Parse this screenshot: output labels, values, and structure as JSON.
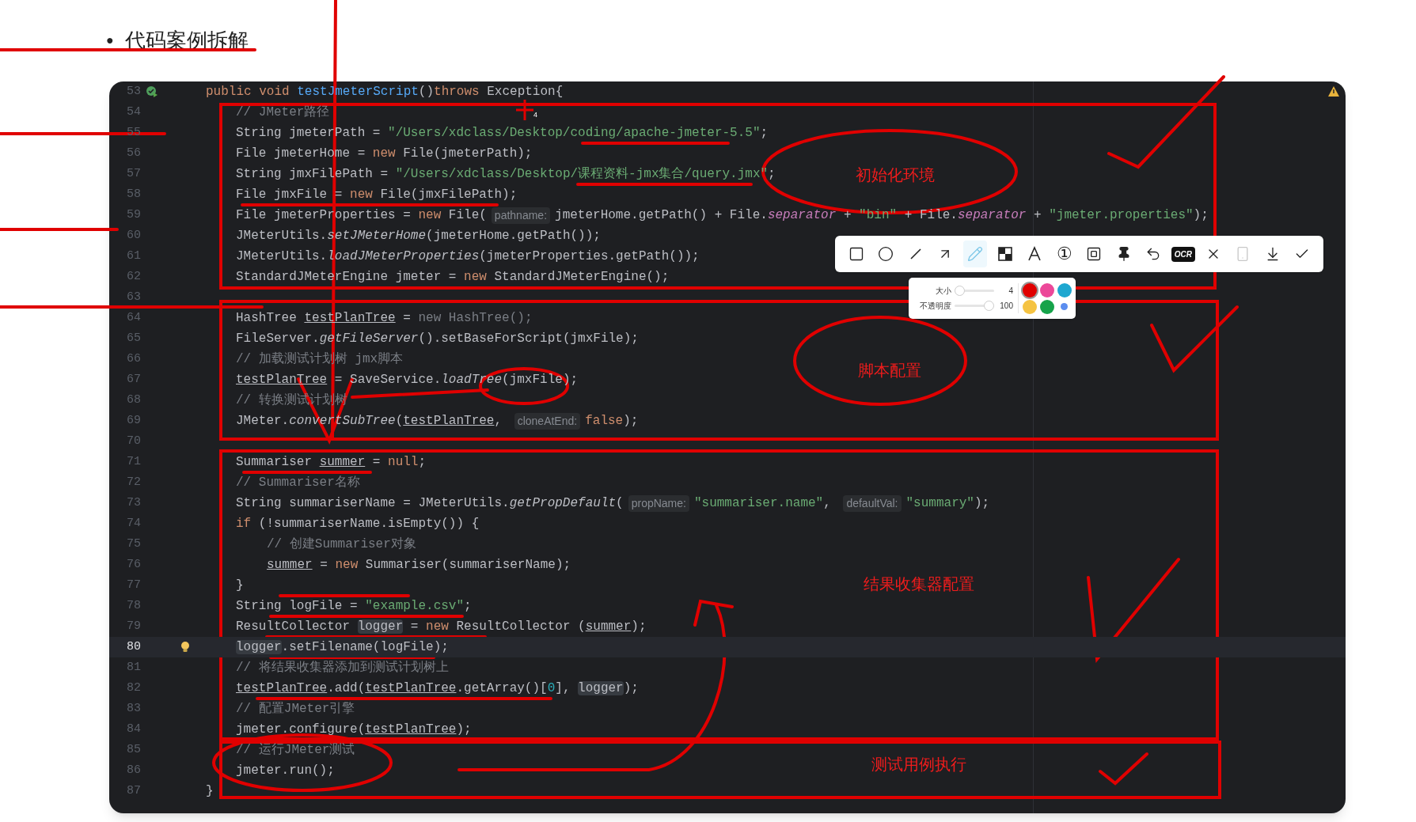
{
  "heading": {
    "bullet": "●",
    "text": "代码案例拆解"
  },
  "editor": {
    "lines": [
      {
        "number": "53",
        "kind": "run",
        "current": false,
        "tokens": [
          {
            "kind": "kw",
            "text": "public void "
          },
          {
            "kind": "fn",
            "text": "testJmeterScript"
          },
          {
            "kind": "p",
            "text": "()"
          },
          {
            "kind": "kw",
            "text": "throws"
          },
          {
            "kind": "p",
            "text": " Exception{"
          }
        ],
        "children": [
          {
            "number": "54",
            "kind": "plain",
            "current": false,
            "tokens": [
              {
                "kind": "c",
                "text": "// JMeter路径"
              }
            ]
          },
          {
            "number": "55",
            "kind": "plain",
            "current": false,
            "tokens": [
              {
                "kind": "p",
                "text": "String jmeterPath = "
              },
              {
                "kind": "s",
                "text": "\"/Users/xdclass/Desktop/coding/apache-jmeter-5.5\""
              },
              {
                "kind": "p",
                "text": ";"
              }
            ]
          },
          {
            "number": "56",
            "kind": "plain",
            "current": false,
            "tokens": [
              {
                "kind": "p",
                "text": "File jmeterHome = "
              },
              {
                "kind": "kw",
                "text": "new"
              },
              {
                "kind": "p",
                "text": " File(jmeterPath);"
              }
            ]
          },
          {
            "number": "57",
            "kind": "plain",
            "current": false,
            "tokens": [
              {
                "kind": "p",
                "text": "String jmxFilePath = "
              },
              {
                "kind": "s",
                "text": "\"/Users/xdclass/Desktop/课程资料-jmx集合/query.jmx\""
              },
              {
                "kind": "p",
                "text": ";"
              }
            ]
          },
          {
            "number": "58",
            "kind": "plain",
            "current": false,
            "tokens": [
              {
                "kind": "p",
                "text": "File jmxFile = "
              },
              {
                "kind": "kw",
                "text": "new"
              },
              {
                "kind": "p",
                "text": " File(jmxFilePath);"
              }
            ]
          },
          {
            "number": "59",
            "kind": "plain",
            "current": false,
            "tokens": [
              {
                "kind": "p",
                "text": "File jmeterProperties = "
              },
              {
                "kind": "kw",
                "text": "new"
              },
              {
                "kind": "p",
                "text": " File("
              },
              {
                "kind": "h",
                "text": "pathname:"
              },
              {
                "kind": "p",
                "text": "jmeterHome.getPath() + File."
              },
              {
                "kind": "f",
                "text": "separator"
              },
              {
                "kind": "p",
                "text": " + "
              },
              {
                "kind": "s",
                "text": "\"bin\""
              },
              {
                "kind": "p",
                "text": " + File."
              },
              {
                "kind": "f",
                "text": "separator"
              },
              {
                "kind": "p",
                "text": " + "
              },
              {
                "kind": "s",
                "text": "\"jmeter.properties\""
              },
              {
                "kind": "p",
                "text": ");"
              }
            ]
          },
          {
            "number": "60",
            "kind": "plain",
            "current": false,
            "tokens": [
              {
                "kind": "p",
                "text": "JMeterUtils."
              },
              {
                "kind": "i",
                "text": "setJMeterHome"
              },
              {
                "kind": "p",
                "text": "(jmeterHome.getPath());"
              }
            ]
          },
          {
            "number": "61",
            "kind": "plain",
            "current": false,
            "tokens": [
              {
                "kind": "p",
                "text": "JMeterUtils."
              },
              {
                "kind": "i",
                "text": "loadJMeterProperties"
              },
              {
                "kind": "p",
                "text": "(jmeterProperties.getPath());"
              }
            ]
          },
          {
            "number": "62",
            "kind": "plain",
            "current": false,
            "tokens": [
              {
                "kind": "p",
                "text": "StandardJMeterEngine jmeter = "
              },
              {
                "kind": "kw",
                "text": "new"
              },
              {
                "kind": "p",
                "text": " StandardJMeterEngine();"
              }
            ]
          },
          {
            "number": "63",
            "kind": "plain",
            "current": false
          },
          {
            "number": "64",
            "kind": "plain",
            "current": false,
            "tokens": [
              {
                "kind": "p",
                "text": "HashTree "
              },
              {
                "kind": "u",
                "text": "testPlanTree"
              },
              {
                "kind": "p",
                "text": " = "
              },
              {
                "kind": "d",
                "text": "new HashTree();"
              }
            ]
          },
          {
            "number": "65",
            "kind": "plain",
            "current": false,
            "tokens": [
              {
                "kind": "p",
                "text": "FileServer."
              },
              {
                "kind": "i",
                "text": "getFileServer"
              },
              {
                "kind": "p",
                "text": "().setBaseForScript(jmxFile);"
              }
            ]
          },
          {
            "number": "66",
            "kind": "plain",
            "current": false,
            "tokens": [
              {
                "kind": "c",
                "text": "// 加载测试计划树 jmx脚本"
              }
            ]
          },
          {
            "number": "67",
            "kind": "plain",
            "current": false,
            "tokens": [
              {
                "kind": "u",
                "text": "testPlanTree"
              },
              {
                "kind": "p",
                "text": " = SaveService."
              },
              {
                "kind": "i",
                "text": "loadTree"
              },
              {
                "kind": "p",
                "text": "(jmxFile);"
              }
            ]
          },
          {
            "number": "68",
            "kind": "plain",
            "current": false,
            "tokens": [
              {
                "kind": "c",
                "text": "// 转换测试计划树"
              }
            ]
          },
          {
            "number": "69",
            "kind": "plain",
            "current": false,
            "tokens": [
              {
                "kind": "p",
                "text": "JMeter."
              },
              {
                "kind": "i",
                "text": "convertSubTree"
              },
              {
                "kind": "p",
                "text": "("
              },
              {
                "kind": "u",
                "text": "testPlanTree"
              },
              {
                "kind": "p",
                "text": ", "
              },
              {
                "kind": "h",
                "text": "cloneAtEnd:"
              },
              {
                "kind": "kw",
                "text": "false"
              },
              {
                "kind": "p",
                "text": ");"
              }
            ]
          },
          {
            "number": "70",
            "kind": "plain",
            "current": false
          },
          {
            "number": "71",
            "kind": "plain",
            "current": false,
            "tokens": [
              {
                "kind": "p",
                "text": "Summariser "
              },
              {
                "kind": "u",
                "text": "summer"
              },
              {
                "kind": "p",
                "text": " = "
              },
              {
                "kind": "kw",
                "text": "null"
              },
              {
                "kind": "p",
                "text": ";"
              }
            ]
          },
          {
            "number": "72",
            "kind": "plain",
            "current": false,
            "tokens": [
              {
                "kind": "c",
                "text": "// Summariser名称"
              }
            ]
          },
          {
            "number": "73",
            "kind": "plain",
            "current": false,
            "tokens": [
              {
                "kind": "p",
                "text": "String summariserName = JMeterUtils."
              },
              {
                "kind": "i",
                "text": "getPropDefault"
              },
              {
                "kind": "p",
                "text": "("
              },
              {
                "kind": "h",
                "text": "propName:"
              },
              {
                "kind": "s",
                "text": "\"summariser.name\""
              },
              {
                "kind": "p",
                "text": ", "
              },
              {
                "kind": "h",
                "text": "defaultVal:"
              },
              {
                "kind": "s",
                "text": "\"summary\""
              },
              {
                "kind": "p",
                "text": ");"
              }
            ]
          },
          {
            "number": "74",
            "kind": "plain",
            "current": false,
            "tokens": [
              {
                "kind": "kw",
                "text": "if"
              },
              {
                "kind": "p",
                "text": " (!summariserName.isEmpty()) {"
              }
            ],
            "children": [
              {
                "number": "75",
                "kind": "plain",
                "current": false,
                "tokens": [
                  {
                    "kind": "c",
                    "text": "// 创建Summariser对象"
                  }
                ]
              },
              {
                "number": "76",
                "kind": "plain",
                "current": false,
                "tokens": [
                  {
                    "kind": "u",
                    "text": "summer"
                  },
                  {
                    "kind": "p",
                    "text": " = "
                  },
                  {
                    "kind": "kw",
                    "text": "new"
                  },
                  {
                    "kind": "p",
                    "text": " Summariser(summariserName);"
                  }
                ]
              }
            ]
          },
          {
            "number": "77",
            "kind": "plain",
            "current": false,
            "tokens": [
              {
                "kind": "p",
                "text": "}"
              }
            ]
          },
          {
            "number": "78",
            "kind": "plain",
            "current": false,
            "tokens": [
              {
                "kind": "p",
                "text": "String logFile = "
              },
              {
                "kind": "s",
                "text": "\"example.csv\""
              },
              {
                "kind": "p",
                "text": ";"
              }
            ]
          },
          {
            "number": "79",
            "kind": "plain",
            "current": false,
            "tokens": [
              {
                "kind": "p",
                "text": "ResultCollector "
              },
              {
                "kind": "m",
                "text": "logger"
              },
              {
                "kind": "p",
                "text": " = "
              },
              {
                "kind": "kw",
                "text": "new"
              },
              {
                "kind": "p",
                "text": " ResultCollector ("
              },
              {
                "kind": "u",
                "text": "summer"
              },
              {
                "kind": "p",
                "text": ");"
              }
            ]
          },
          {
            "number": "80",
            "kind": "bulb",
            "current": true,
            "tokens": [
              {
                "kind": "m",
                "text": "logger"
              },
              {
                "kind": "p",
                "text": ".setFilename(logFile);"
              }
            ]
          },
          {
            "number": "81",
            "kind": "plain",
            "current": false,
            "tokens": [
              {
                "kind": "c",
                "text": "// 将结果收集器添加到测试计划树上"
              }
            ]
          },
          {
            "number": "82",
            "kind": "plain",
            "current": false,
            "tokens": [
              {
                "kind": "u",
                "text": "testPlanTree"
              },
              {
                "kind": "p",
                "text": ".add("
              },
              {
                "kind": "u",
                "text": "testPlanTree"
              },
              {
                "kind": "p",
                "text": ".getArray()["
              },
              {
                "kind": "n",
                "text": "0"
              },
              {
                "kind": "p",
                "text": "], "
              },
              {
                "kind": "m",
                "text": "logger"
              },
              {
                "kind": "p",
                "text": ");"
              }
            ]
          },
          {
            "number": "83",
            "kind": "plain",
            "current": false,
            "tokens": [
              {
                "kind": "c",
                "text": "// 配置JMeter引擎"
              }
            ]
          },
          {
            "number": "84",
            "kind": "plain",
            "current": false,
            "tokens": [
              {
                "kind": "p",
                "text": "jmeter.configure("
              },
              {
                "kind": "u",
                "text": "testPlanTree"
              },
              {
                "kind": "p",
                "text": ");"
              }
            ]
          },
          {
            "number": "85",
            "kind": "plain",
            "current": false,
            "tokens": [
              {
                "kind": "c",
                "text": "// 运行JMeter测试"
              }
            ]
          },
          {
            "number": "86",
            "kind": "plain",
            "current": false,
            "tokens": [
              {
                "kind": "p",
                "text": "jmeter.run();"
              }
            ]
          }
        ]
      },
      {
        "number": "87",
        "kind": "plain",
        "current": false,
        "tokens": [
          {
            "kind": "p",
            "text": "}"
          }
        ]
      }
    ]
  },
  "annotations": [
    {
      "label": "初始化环境"
    },
    {
      "label": "脚本配置"
    },
    {
      "label": "结果收集器配置"
    },
    {
      "label": "测试用例执行"
    }
  ],
  "cursor": {
    "text": "4"
  },
  "toolbar": {
    "tools": [
      {
        "kind": "rect",
        "selected": false,
        "disabled": false
      },
      {
        "kind": "ellipse",
        "selected": false,
        "disabled": false
      },
      {
        "kind": "line",
        "selected": false,
        "disabled": false
      },
      {
        "kind": "arrow",
        "selected": false,
        "disabled": false
      },
      {
        "kind": "pen",
        "selected": true,
        "disabled": false
      },
      {
        "kind": "mosaic",
        "selected": false,
        "disabled": false
      },
      {
        "kind": "text",
        "selected": false,
        "disabled": false
      },
      {
        "kind": "number",
        "text": "①",
        "selected": false,
        "disabled": false
      },
      {
        "kind": "frame",
        "selected": false,
        "disabled": false
      },
      {
        "kind": "pin",
        "selected": false,
        "disabled": false
      },
      {
        "kind": "undo",
        "selected": false,
        "disabled": false
      },
      {
        "kind": "ocr",
        "text": "OCR",
        "selected": false,
        "disabled": false
      },
      {
        "kind": "close",
        "selected": false,
        "disabled": false
      },
      {
        "kind": "long",
        "selected": false,
        "disabled": true
      },
      {
        "kind": "download",
        "selected": false,
        "disabled": false
      },
      {
        "kind": "done",
        "selected": false,
        "disabled": false
      }
    ]
  },
  "pen_options": {
    "sliders": [
      {
        "label": "大小",
        "level": 0.0,
        "reading": "4"
      },
      {
        "label": "不透明度",
        "level": 1.0,
        "reading": "100"
      }
    ],
    "colors": [
      {
        "color": "#e00000",
        "selected": true
      },
      {
        "color": "#ec4899",
        "selected": false
      },
      {
        "color": "#1ea7d0",
        "selected": false
      },
      {
        "color": "#f5c342",
        "selected": false
      },
      {
        "color": "#16a34a",
        "selected": false
      },
      {
        "color": "#5b8def",
        "selected": false
      }
    ]
  }
}
